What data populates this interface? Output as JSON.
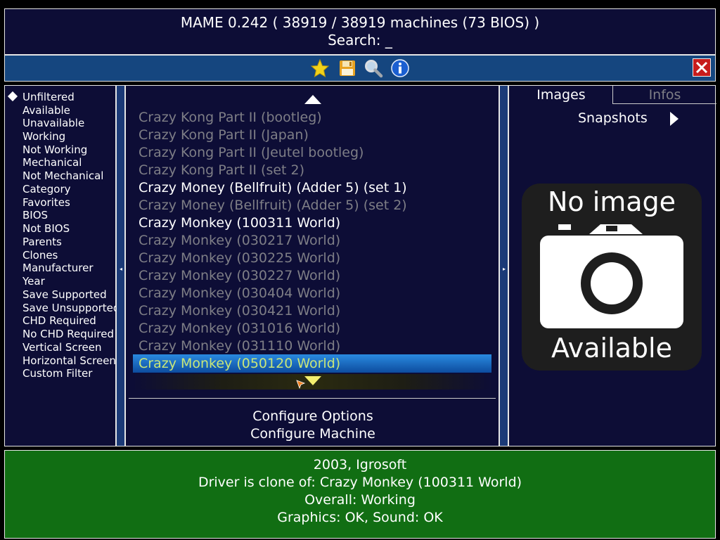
{
  "header": {
    "title": "MAME 0.242 ( 38919 / 38919 machines (73 BIOS) )",
    "search_label": "Search: _"
  },
  "toolbar": {
    "icons": [
      "star-icon",
      "floppy-disk-icon",
      "magnifier-icon",
      "info-icon"
    ],
    "close_icon": "close-icon"
  },
  "filters": {
    "selected": "Unfiltered",
    "items": [
      "Unfiltered",
      "Available",
      "Unavailable",
      "Working",
      "Not Working",
      "Mechanical",
      "Not Mechanical",
      "Category",
      "Favorites",
      "BIOS",
      "Not BIOS",
      "Parents",
      "Clones",
      "Manufacturer",
      "Year",
      "Save Supported",
      "Save Unsupported",
      "CHD Required",
      "No CHD Required",
      "Vertical Screen",
      "Horizontal Screen",
      "Custom Filter"
    ]
  },
  "machine_list": {
    "items": [
      {
        "name": "Crazy Kong Part II (bootleg)",
        "available": false
      },
      {
        "name": "Crazy Kong Part II (Japan)",
        "available": false
      },
      {
        "name": "Crazy Kong Part II (Jeutel bootleg)",
        "available": false
      },
      {
        "name": "Crazy Kong Part II (set 2)",
        "available": false
      },
      {
        "name": "Crazy Money (Bellfruit) (Adder 5) (set 1)",
        "available": true
      },
      {
        "name": "Crazy Money (Bellfruit) (Adder 5) (set 2)",
        "available": false
      },
      {
        "name": "Crazy Monkey (100311 World)",
        "available": true
      },
      {
        "name": "Crazy Monkey (030217 World)",
        "available": false
      },
      {
        "name": "Crazy Monkey (030225 World)",
        "available": false
      },
      {
        "name": "Crazy Monkey (030227 World)",
        "available": false
      },
      {
        "name": "Crazy Monkey (030404 World)",
        "available": false
      },
      {
        "name": "Crazy Monkey (030421 World)",
        "available": false
      },
      {
        "name": "Crazy Monkey (031016 World)",
        "available": false
      },
      {
        "name": "Crazy Monkey (031110 World)",
        "available": false
      },
      {
        "name": "Crazy Monkey (050120 World)",
        "available": false
      }
    ],
    "selected": "Crazy Monkey (050120 World)",
    "colors": {
      "available": "#ffffff",
      "unavailable": "#7e7e86",
      "selected_text": "#c8e67a",
      "selection": "#1a6fc4"
    }
  },
  "actions": {
    "configure_options": "Configure Options",
    "configure_machine": "Configure Machine"
  },
  "right_panel": {
    "tabs": [
      "Images",
      "Infos"
    ],
    "active_tab": "Images",
    "image_type": "Snapshots",
    "no_image": {
      "line1": "No image",
      "line2": "Available"
    }
  },
  "info": {
    "line1": "2003, Igrosoft",
    "line2": "Driver is clone of: Crazy Monkey (100311 World)",
    "line3": "Overall: Working",
    "line4": "Graphics: OK, Sound: OK"
  },
  "colors": {
    "panel_bg": "#0d0d36",
    "toolbar_bg": "#15467f",
    "info_bg": "#116e13",
    "close_bg": "#c71c1c"
  }
}
